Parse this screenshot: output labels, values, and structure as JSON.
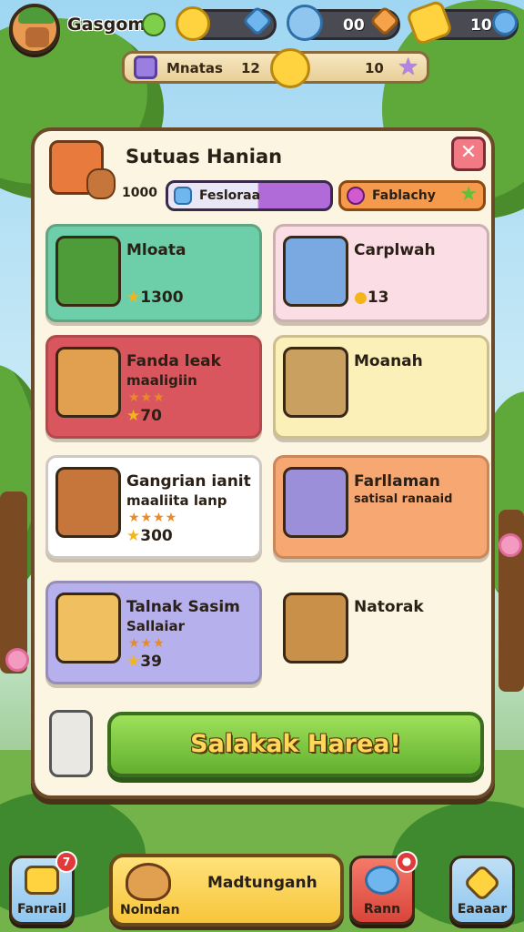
{
  "player": {
    "name": "Gasgom"
  },
  "currencies": [
    {
      "icon": "gold-coin-icon",
      "value": ""
    },
    {
      "icon": "blue-gem-icon",
      "value": "00"
    },
    {
      "icon": "gold-bar-icon",
      "value": "10"
    }
  ],
  "subbar": {
    "label": "Mnatas",
    "value_left": "12",
    "value_right": "10"
  },
  "panel": {
    "title": "Sutuas Hanian",
    "subtitle_value": "1000",
    "tags": [
      {
        "label": "Fesloraa"
      },
      {
        "label": "Fablachy"
      }
    ]
  },
  "cards": [
    {
      "title": "Mloata",
      "sub": "",
      "stars": "",
      "reward": "1300",
      "bg": "#6dcfa9"
    },
    {
      "title": "Carplwah",
      "sub": "",
      "stars": "",
      "reward": "13",
      "bg": "#fbdde6"
    },
    {
      "title": "Fanda leak",
      "sub": "maaligiin",
      "stars": "★★★",
      "reward": "70",
      "bg": "#d9565f"
    },
    {
      "title": "Moanah",
      "sub": "",
      "stars": "",
      "reward": "",
      "bg": "#fbf0b8"
    },
    {
      "title": "Gangrian ianit",
      "sub": "maaliita lanp",
      "stars": "★★★★",
      "reward": "300",
      "bg": "#ffffff"
    },
    {
      "title": "Farllaman",
      "sub": "satisal ranaaid",
      "stars": "",
      "reward": "",
      "bg": "#f7a872"
    },
    {
      "title": "Talnak Sasim",
      "sub": "Sallaiar",
      "stars": "★★★",
      "reward": "39",
      "bg": "#b6b0ec"
    },
    {
      "title": "Natorak",
      "sub": "",
      "stars": "",
      "reward": "",
      "bg": "#fcf5e2"
    }
  ],
  "cta": {
    "label": "Salakak Harea!"
  },
  "nav": [
    {
      "label": "Fanrail",
      "badge": "7"
    },
    {
      "label": "Nolndan",
      "main": "Madtunganh"
    },
    {
      "label": "Rann",
      "badge": ""
    },
    {
      "label": "Eaaaar"
    }
  ],
  "colors": {
    "cta_green": "#62b02e",
    "panel_bg": "#fcf5e2",
    "close_red": "#f27a84"
  }
}
